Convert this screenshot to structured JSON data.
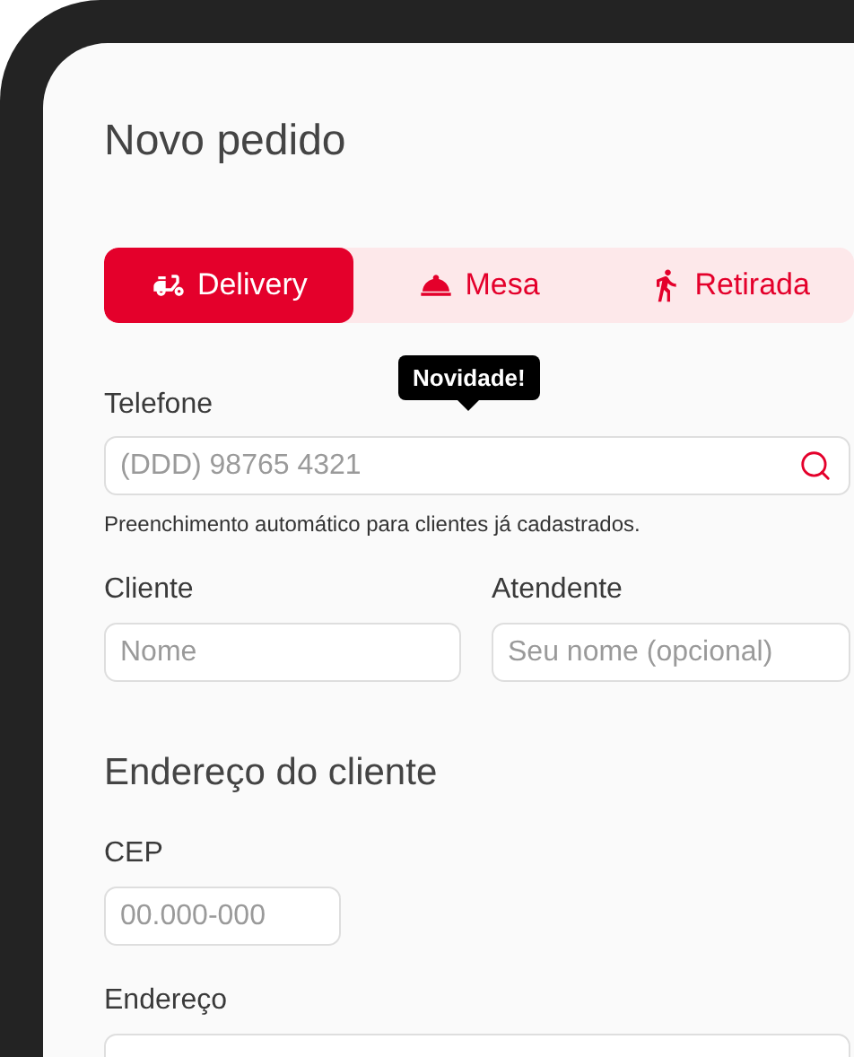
{
  "title": "Novo pedido",
  "tabs": [
    {
      "label": "Delivery",
      "selected": true
    },
    {
      "label": "Mesa",
      "selected": false
    },
    {
      "label": "Retirada",
      "selected": false
    }
  ],
  "phone": {
    "label": "Telefone",
    "placeholder": "(DDD) 98765 4321",
    "tooltip": "Novidade!",
    "hint": "Preenchimento automático para clientes já cadastrados."
  },
  "client": {
    "label": "Cliente",
    "placeholder": "Nome"
  },
  "attendant": {
    "label": "Atendente",
    "placeholder": "Seu nome (opcional)"
  },
  "address_section": {
    "heading": "Endereço do cliente",
    "cep": {
      "label": "CEP",
      "placeholder": "00.000-000"
    },
    "address": {
      "label": "Endereço"
    }
  }
}
